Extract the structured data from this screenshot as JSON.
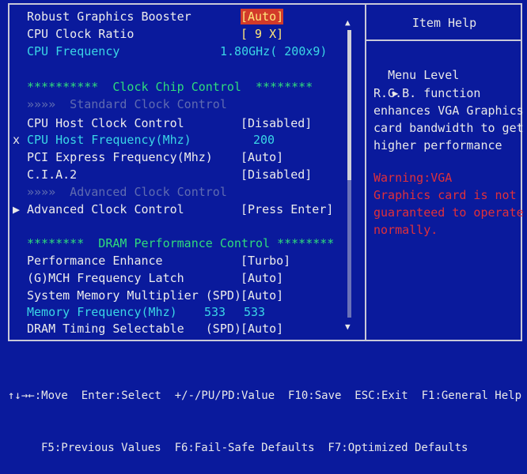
{
  "settings": {
    "robust_graphics": {
      "label": "Robust Graphics Booster",
      "value": "[Auto]"
    },
    "cpu_clock_ratio": {
      "label": "CPU Clock Ratio",
      "value": "[ 9 X]"
    },
    "cpu_frequency": {
      "label": "CPU Frequency",
      "value": "1.80GHz( 200x9)"
    },
    "clock_chip_header": "**********  Clock Chip Control  ********",
    "standard_clock": "»»»»  Standard Clock Control",
    "cpu_host_clock_control": {
      "label": "CPU Host Clock Control",
      "value": "[Disabled]"
    },
    "cpu_host_frequency": {
      "marker": "x",
      "label": "CPU Host Frequency(Mhz)",
      "value": "200"
    },
    "pci_express_frequency": {
      "label": "PCI Express Frequency(Mhz)",
      "value": "[Auto]"
    },
    "cia2": {
      "label": "C.I.A.2",
      "value": "[Disabled]"
    },
    "advanced_clock_header": "»»»»  Advanced Clock Control",
    "advanced_clock_control": {
      "marker": "▶",
      "label": "Advanced Clock Control",
      "value": "[Press Enter]"
    },
    "dram_header": "********  DRAM Performance Control ********",
    "performance_enhance": {
      "label": "Performance Enhance",
      "value": "[Turbo]"
    },
    "mch_frequency_latch": {
      "label": "(G)MCH Frequency Latch",
      "value": "[Auto]"
    },
    "system_memory_multiplier": {
      "label": "System Memory Multiplier (SPD)",
      "value": "[Auto]"
    },
    "memory_frequency": {
      "label": "Memory Frequency(Mhz)",
      "value1": "533",
      "value2": "533"
    },
    "dram_timing_selectable": {
      "label": "DRAM Timing Selectable   (SPD)",
      "value": "[Auto]"
    }
  },
  "help": {
    "title": "Item Help",
    "menu_level": "Menu Level",
    "menu_level_arrow": "▶",
    "description": [
      "R.G.B. function",
      "enhances VGA Graphics",
      "card bandwidth to get",
      "higher performance"
    ],
    "warning": [
      "Warning:VGA",
      "Graphics card is not",
      "guaranteed to operate",
      "normally."
    ]
  },
  "footer": {
    "line1": "↑↓→←:Move  Enter:Select  +/-/PU/PD:Value  F10:Save  ESC:Exit  F1:General Help",
    "line2": "F5:Previous Values  F6:Fail-Safe Defaults  F7:Optimized Defaults"
  },
  "colors": {
    "background": "#0a1a9c",
    "highlight": "#d23a2a",
    "accent_cyan": "#3ad6e6",
    "header_green": "#2fdc7c",
    "warning_red": "#e0303a"
  }
}
